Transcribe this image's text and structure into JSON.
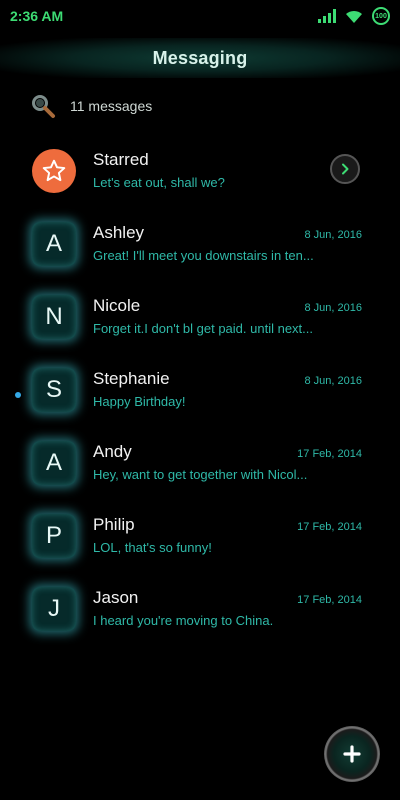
{
  "status_bar": {
    "time": "2:36 AM",
    "battery": "100",
    "icons": [
      "signal-icon",
      "wifi-icon",
      "battery-icon"
    ]
  },
  "header": {
    "title": "Messaging"
  },
  "search": {
    "count_text": "11 messages"
  },
  "colors": {
    "accent": "#2fb9a8",
    "status": "#3ddc74",
    "starred": "#ee6c3d",
    "unread": "#35a9e6"
  },
  "starred": {
    "name": "Starred",
    "preview": "Let's eat out, shall we?"
  },
  "conversations": [
    {
      "initial": "A",
      "name": "Ashley",
      "date": "8 Jun, 2016",
      "preview": "Great! I'll meet you downstairs in ten...",
      "unread": false
    },
    {
      "initial": "N",
      "name": "Nicole",
      "date": "8 Jun, 2016",
      "preview": "Forget it.I don't bl get paid. until next...",
      "unread": false
    },
    {
      "initial": "S",
      "name": "Stephanie",
      "date": "8 Jun, 2016",
      "preview": "Happy Birthday!",
      "unread": true
    },
    {
      "initial": "A",
      "name": "Andy",
      "date": "17 Feb, 2014",
      "preview": "Hey, want to get together with Nicol...",
      "unread": false
    },
    {
      "initial": "P",
      "name": "Philip",
      "date": "17 Feb, 2014",
      "preview": "LOL, that's so funny!",
      "unread": false
    },
    {
      "initial": "J",
      "name": "Jason",
      "date": "17 Feb, 2014",
      "preview": "I heard you're moving to China.",
      "unread": false
    }
  ]
}
